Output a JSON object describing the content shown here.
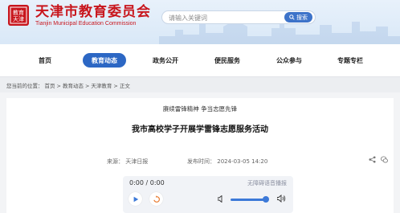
{
  "header": {
    "logo_text": "教育天津",
    "title_cn": "天津市教育委员会",
    "title_en": "Tianjin Municipal Education Commission",
    "search_placeholder": "请输入关键词",
    "search_button": "搜索"
  },
  "nav": {
    "items": [
      {
        "label": "首页",
        "active": false
      },
      {
        "label": "教育动态",
        "active": true
      },
      {
        "label": "政务公开",
        "active": false
      },
      {
        "label": "便民服务",
        "active": false
      },
      {
        "label": "公众参与",
        "active": false
      },
      {
        "label": "专题专栏",
        "active": false
      }
    ]
  },
  "breadcrumb": {
    "prefix": "您当前的位置：",
    "items": [
      "首页",
      "教育动态",
      "天津教育",
      "正文"
    ],
    "separator": ">"
  },
  "article": {
    "subtitle": "赓续雷锋精神 争当志愿先锋",
    "title": "我市高校学子开展学雷锋志愿服务活动",
    "source_label": "来源：",
    "source": "天津日报",
    "date_label": "发布时间：",
    "date": "2024-03-05 14:20"
  },
  "player": {
    "time": "0:00 / 0:00",
    "label": "无障碍语音播报"
  },
  "colors": {
    "brand_red": "#c8161d",
    "nav_active": "#2c67c4",
    "accent_blue": "#3c79d8"
  }
}
